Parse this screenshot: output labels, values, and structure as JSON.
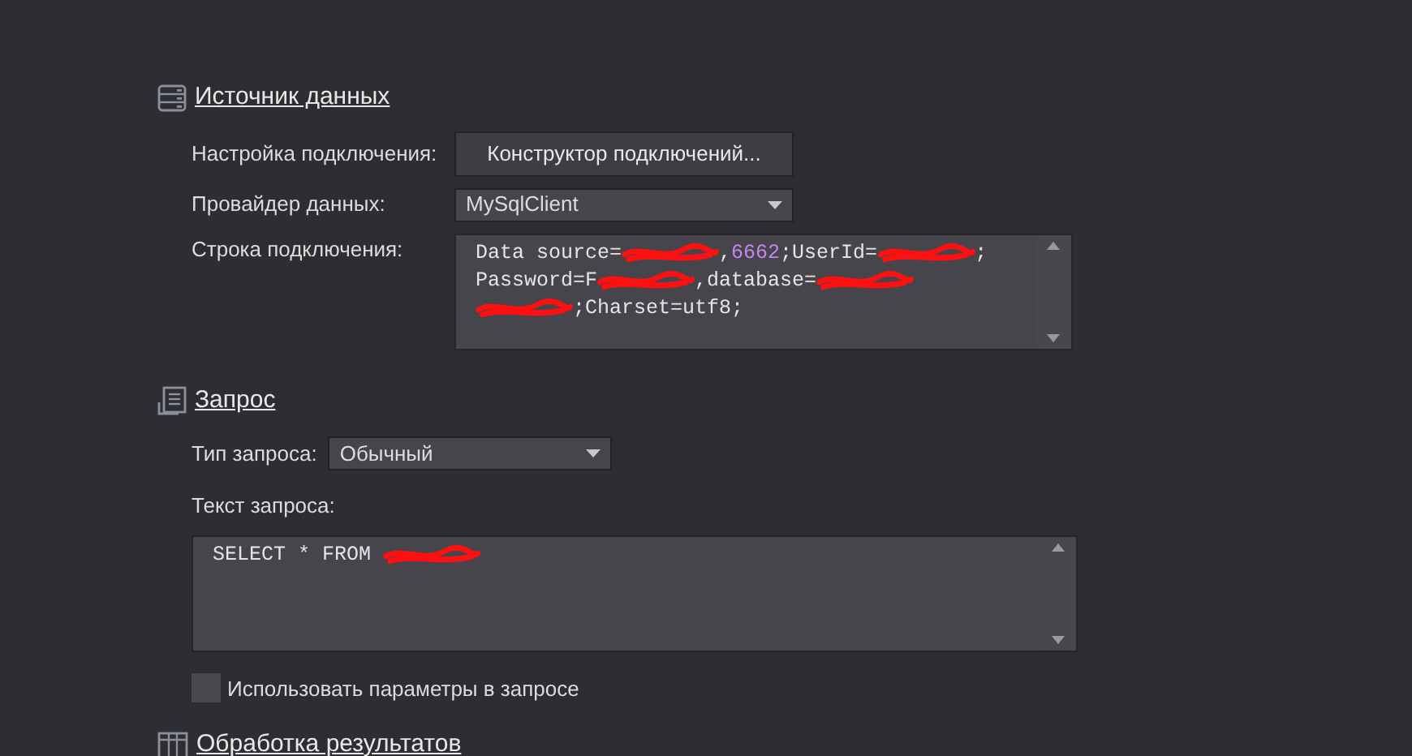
{
  "sections": [
    {
      "kind": "datasource",
      "title": "Источник данных",
      "fields": [
        {
          "kind": "button",
          "label": "Настройка подключения:",
          "value": "Конструктор подключений..."
        },
        {
          "kind": "dropdown",
          "label": "Провайдер данных:",
          "value": "MySqlClient"
        },
        {
          "kind": "code",
          "label": "Строка подключения:",
          "lines": [
            [
              {
                "kind": "text",
                "text": "Data source="
              },
              {
                "kind": "redacted"
              },
              {
                "kind": "text",
                "text": ","
              },
              {
                "kind": "number",
                "text": "6662"
              },
              {
                "kind": "text",
                "text": ";UserId="
              },
              {
                "kind": "redacted"
              },
              {
                "kind": "text",
                "text": ";"
              }
            ],
            [
              {
                "kind": "text",
                "text": "Password=F"
              },
              {
                "kind": "redacted"
              },
              {
                "kind": "text",
                "text": ",database="
              },
              {
                "kind": "redacted"
              }
            ],
            [
              {
                "kind": "redacted"
              },
              {
                "kind": "text",
                "text": ";Charset=utf8;"
              }
            ]
          ]
        }
      ]
    },
    {
      "kind": "query",
      "title": "Запрос",
      "fields": [
        {
          "kind": "inline-dropdown",
          "label": "Тип запроса:",
          "value": "Обычный"
        },
        {
          "kind": "code-wide",
          "label": "Текст запроса:",
          "lines": [
            [
              {
                "kind": "text",
                "text": "SELECT * FROM "
              },
              {
                "kind": "redacted"
              }
            ]
          ]
        },
        {
          "kind": "checkbox",
          "label": "Использовать параметры в запросе",
          "checked": false
        }
      ]
    },
    {
      "kind": "table",
      "title": "Обработка результатов"
    }
  ]
}
